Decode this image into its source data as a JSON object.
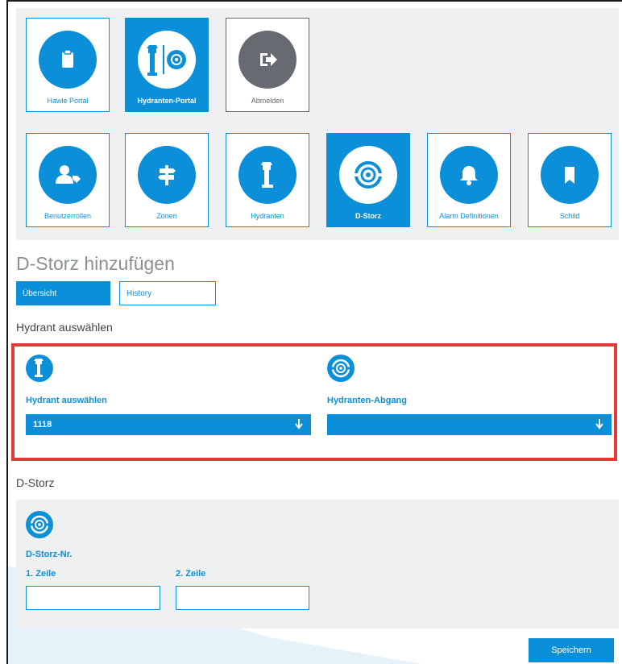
{
  "top_tiles": [
    {
      "label": "Hawle Portal",
      "icon": "clipboard-icon",
      "state": "normal"
    },
    {
      "label": "Hydranten-Portal",
      "icon": "hydrant-portal-icon",
      "state": "active"
    },
    {
      "label": "Abmelden",
      "icon": "logout-icon",
      "state": "gray"
    }
  ],
  "nav_tiles": [
    {
      "label": "Benutzerrollen",
      "icon": "user-roles-icon",
      "state": "normal"
    },
    {
      "label": "Zonen",
      "icon": "signpost-icon",
      "state": "normal"
    },
    {
      "label": "Hydranten",
      "icon": "hydrant-icon",
      "state": "normal"
    },
    {
      "label": "D-Storz",
      "icon": "coupling-icon",
      "state": "active"
    },
    {
      "label": "Alarm Definitionen",
      "icon": "bell-icon",
      "state": "normal"
    },
    {
      "label": "Schild",
      "icon": "bookmark-icon",
      "state": "normal"
    }
  ],
  "page_title": "D-Storz hinzufügen",
  "tabs": {
    "overview": "Übersicht",
    "history": "History"
  },
  "hydrant_section": {
    "title": "Hydrant auswählen",
    "hydrant_field": {
      "label": "Hydrant auswählen",
      "value": "1118"
    },
    "outlet_field": {
      "label": "Hydranten-Abgang",
      "value": ""
    }
  },
  "dstorz_section": {
    "title": "D-Storz",
    "field_label": "D-Storz-Nr.",
    "line1_label": "1. Zeile",
    "line1_value": "",
    "line2_label": "2. Zeile",
    "line2_value": ""
  },
  "save_button": "Speichern",
  "colors": {
    "accent": "#0b8fd8",
    "panel": "#eef0f2",
    "highlight": "#e53935",
    "logout": "#676a70"
  }
}
